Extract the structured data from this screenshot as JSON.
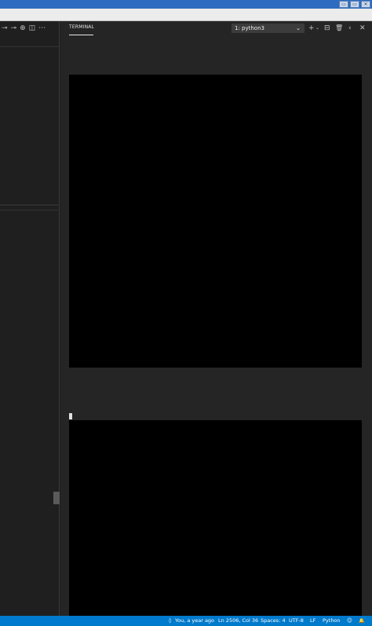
{
  "os": {
    "controls": [
      "▭",
      "▭",
      "✕"
    ]
  },
  "left_toolbar": {
    "icons": [
      "⊸",
      "⊸",
      "⊕",
      "◫",
      "⋯"
    ]
  },
  "panel": {
    "tab_label": "TERMINAL",
    "terminal_select": "1: python3",
    "select_chevron": "⌄",
    "add_icon": "+",
    "add_chevron": "⌄",
    "split_icon": "⊟",
    "trash_icon": "🗑",
    "collapse_icon": "‹",
    "close_icon": "✕"
  },
  "status_bar": {
    "blame": "You, a year ago",
    "blame_icon": "◊",
    "cursor_position": "Ln 2506, Col 36",
    "indentation": "Spaces: 4",
    "encoding": "UTF-8",
    "eol": "LF",
    "language": "Python",
    "feedback_icon": "☺",
    "bell_icon": "🔔"
  },
  "colors": {
    "status_bar": "#007acc",
    "terminal_bg": "#000000",
    "panel_bg": "#252526"
  }
}
